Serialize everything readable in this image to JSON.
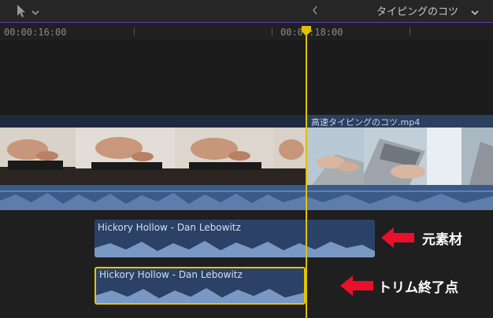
{
  "toolbar": {
    "pointer_icon": "arrow-pointer-icon",
    "chevron_left": "‹",
    "project_title": "タイピングのコツ",
    "project_chevron": "⌄"
  },
  "ruler": {
    "timecode_left": "00:00:16:00",
    "timecode_right": "00:00:18:00"
  },
  "timeline": {
    "video_clip_2_title": "高速タイピングのコツ.mp4",
    "music_clip_original_title": "Hickory Hollow - Dan Lebowitz",
    "music_clip_trimmed_title": "Hickory Hollow - Dan Lebowitz"
  },
  "annotations": {
    "original_label": "元素材",
    "trim_end_label": "トリム終了点"
  },
  "colors": {
    "accent_red": "#e8102a",
    "playhead": "#e0c000",
    "clip_blue": "#2b3f5e"
  }
}
